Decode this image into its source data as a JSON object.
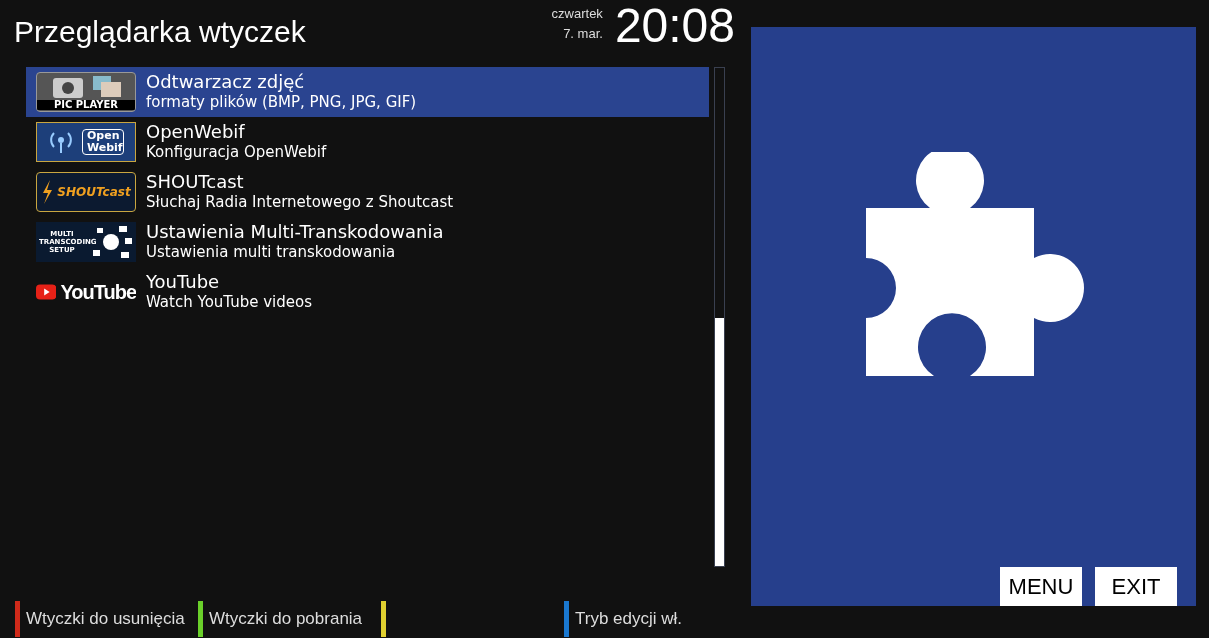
{
  "title": "Przeglądarka wtyczek",
  "clock": {
    "day": "czwartek",
    "date": "7. mar.",
    "time": "20:08"
  },
  "plugins": [
    {
      "name": "Odtwarzacz zdjęć",
      "description": "formaty plików (BMP, PNG, JPG, GIF)",
      "kind": "picplayer",
      "icon_text": "PIC PLAYER",
      "selected": true
    },
    {
      "name": "OpenWebif",
      "description": "Konfiguracja OpenWebif",
      "kind": "openwebif",
      "icon_text": "Open Webif",
      "selected": false
    },
    {
      "name": "SHOUTcast",
      "description": "Słuchaj Radia Internetowego z Shoutcast",
      "kind": "shoutcast",
      "icon_text": "SHOUTcast",
      "selected": false
    },
    {
      "name": "Ustawienia Multi-Transkodowania",
      "description": "Ustawienia multi transkodowania",
      "kind": "transcoding",
      "icon_text": "MULTI TRANSCODING SETUP",
      "selected": false
    },
    {
      "name": "YouTube",
      "description": "Watch YouTube videos",
      "kind": "youtube",
      "icon_text": "YouTube",
      "selected": false
    }
  ],
  "buttons": [
    "MENU",
    "EXIT"
  ],
  "color_keys": [
    {
      "label": "Wtyczki do usunięcia",
      "color": "#d02a1a"
    },
    {
      "label": "Wtyczki do pobrania",
      "color": "#6ad02a"
    },
    {
      "color": "#e0d030"
    },
    {
      "label": "Tryb edycji wł.",
      "color": "#1a78d0"
    }
  ]
}
